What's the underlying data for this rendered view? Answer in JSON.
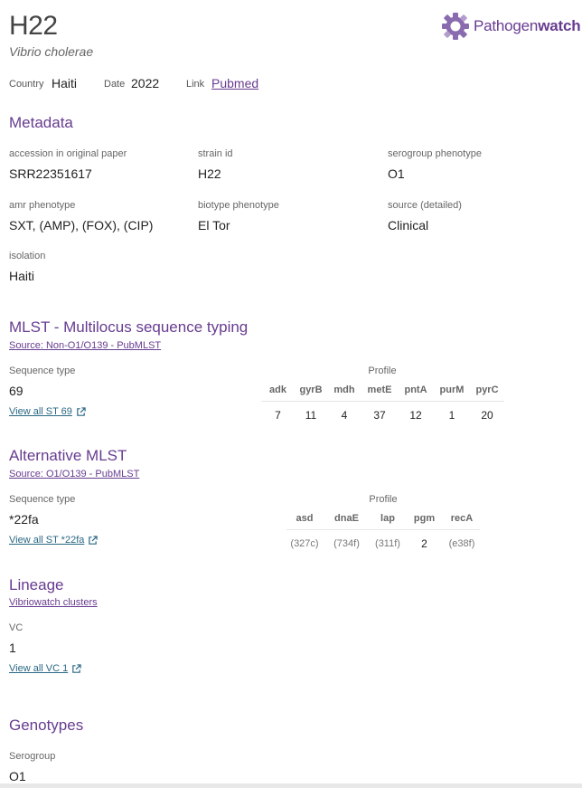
{
  "header": {
    "title": "H22",
    "species": "Vibrio cholerae",
    "country_label": "Country",
    "country_value": "Haiti",
    "date_label": "Date",
    "date_value": "2022",
    "link_label": "Link",
    "link_value": "Pubmed",
    "logo_text_main": "Pathogen",
    "logo_text_bold": "watch"
  },
  "metadata": {
    "heading": "Metadata",
    "fields": [
      {
        "label": "accession in original paper",
        "value": "SRR22351617"
      },
      {
        "label": "strain id",
        "value": "H22"
      },
      {
        "label": "serogroup phenotype",
        "value": "O1"
      },
      {
        "label": "amr phenotype",
        "value": "SXT, (AMP), (FOX), (CIP)"
      },
      {
        "label": "biotype phenotype",
        "value": "El Tor"
      },
      {
        "label": "source (detailed)",
        "value": "Clinical"
      },
      {
        "label": "isolation",
        "value": "Haiti"
      }
    ]
  },
  "mlst": {
    "heading": "MLST - Multilocus sequence typing",
    "source": "Source: Non-O1/O139 - PubMLST",
    "st_label": "Sequence type",
    "st_value": "69",
    "view_all": "View all ST 69",
    "profile_label": "Profile",
    "genes": [
      "adk",
      "gyrB",
      "mdh",
      "metE",
      "pntA",
      "purM",
      "pyrC"
    ],
    "alleles": [
      "7",
      "11",
      "4",
      "37",
      "12",
      "1",
      "20"
    ]
  },
  "alt_mlst": {
    "heading": "Alternative MLST",
    "source": "Source: O1/O139 - PubMLST",
    "st_label": "Sequence type",
    "st_value": "*22fa",
    "view_all": "View all ST *22fa",
    "profile_label": "Profile",
    "genes": [
      "asd",
      "dnaE",
      "lap",
      "pgm",
      "recA"
    ],
    "alleles": [
      "(327c)",
      "(734f)",
      "(311f)",
      "2",
      "(e38f)"
    ]
  },
  "lineage": {
    "heading": "Lineage",
    "source": "Vibriowatch clusters",
    "label": "VC",
    "value": "1",
    "view_all": "View all VC 1"
  },
  "genotypes": {
    "heading": "Genotypes",
    "label": "Serogroup",
    "value": "O1"
  },
  "colors": {
    "accent": "#673c90",
    "link": "#2a6883"
  },
  "icons": {
    "external_link": "external-link-icon",
    "logo": "pathogenwatch-logo-icon"
  }
}
